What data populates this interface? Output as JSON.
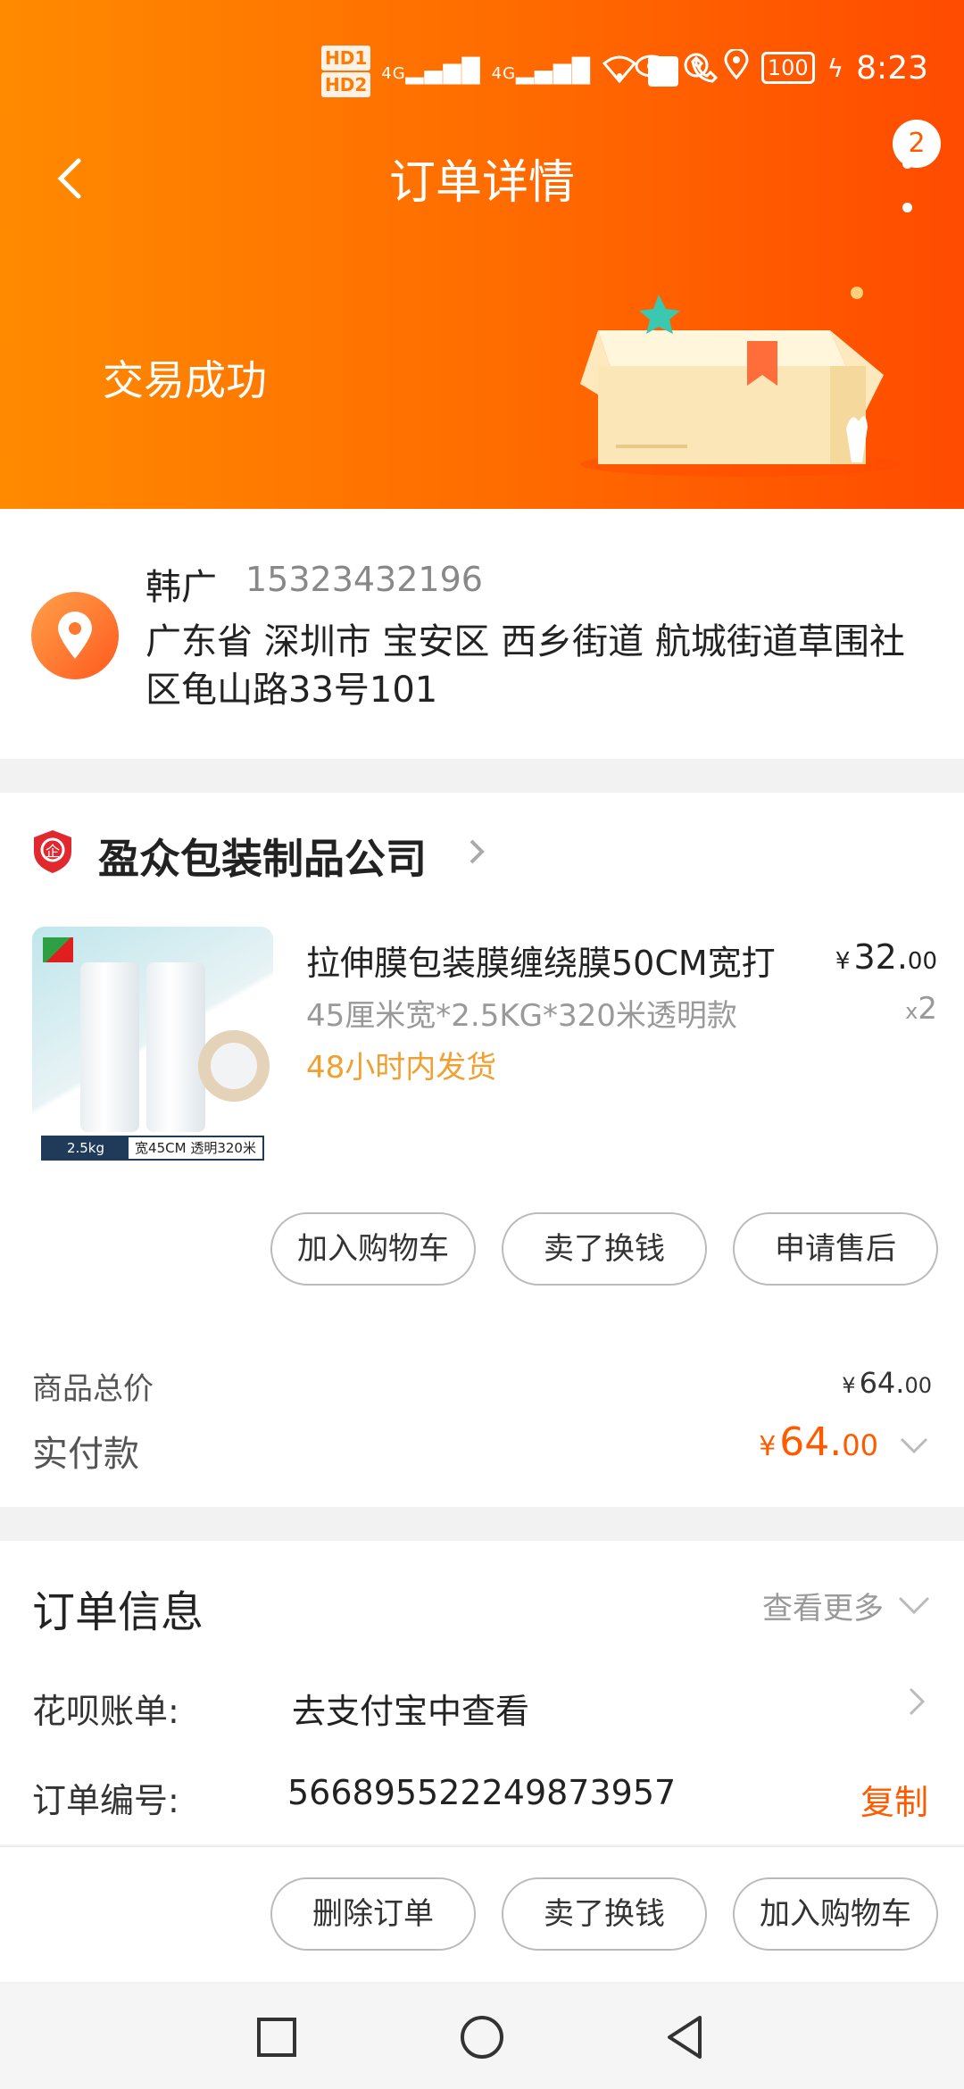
{
  "status_bar": {
    "sim1": "HD1",
    "sim2": "HD2",
    "net1": "4G",
    "net2": "4G",
    "battery": "100",
    "time": "8:23"
  },
  "nav": {
    "title": "订单详情",
    "badge": "2",
    "back_icon": "chevron-left-icon",
    "more_icon": "more-vertical-icon"
  },
  "order_status": "交易成功",
  "address": {
    "name": "韩广",
    "phone": "15323432196",
    "detail": "广东省 深圳市 宝安区 西乡街道 航城街道草围社区龟山路33号101"
  },
  "shop": {
    "name": "盈众包装制品公司"
  },
  "product": {
    "title": "拉伸膜包装膜缠绕膜50CM宽打",
    "spec": "45厘米宽*2.5KG*320米透明款",
    "shipping": "48小时内发货",
    "price_currency": "¥",
    "price_int": "32.",
    "price_dec": "00",
    "qty_prefix": "x",
    "qty": "2",
    "image_tag_weight": "2.5kg",
    "image_tag_desc": "宽45CM 透明320米"
  },
  "item_actions": {
    "add_cart": "加入购物车",
    "resell": "卖了换钱",
    "after_sale": "申请售后"
  },
  "totals": {
    "goods_label": "商品总价",
    "goods_currency": "¥",
    "goods_int": "64.",
    "goods_dec": "00",
    "paid_label": "实付款",
    "paid_currency": "¥",
    "paid_int": "64.",
    "paid_dec": "00"
  },
  "order_info": {
    "title": "订单信息",
    "more": "查看更多",
    "huabei_label": "花呗账单:",
    "huabei_value": "去支付宝中查看",
    "order_no_label": "订单编号:",
    "order_no_value": "566895522249873957",
    "copy": "复制"
  },
  "bottom_actions": {
    "delete": "删除订单",
    "resell": "卖了换钱",
    "add_cart": "加入购物车"
  },
  "colors": {
    "brand_orange": "#ff6a00",
    "price_orange": "#ff5a00",
    "shipping_yellow": "#f0a030"
  }
}
